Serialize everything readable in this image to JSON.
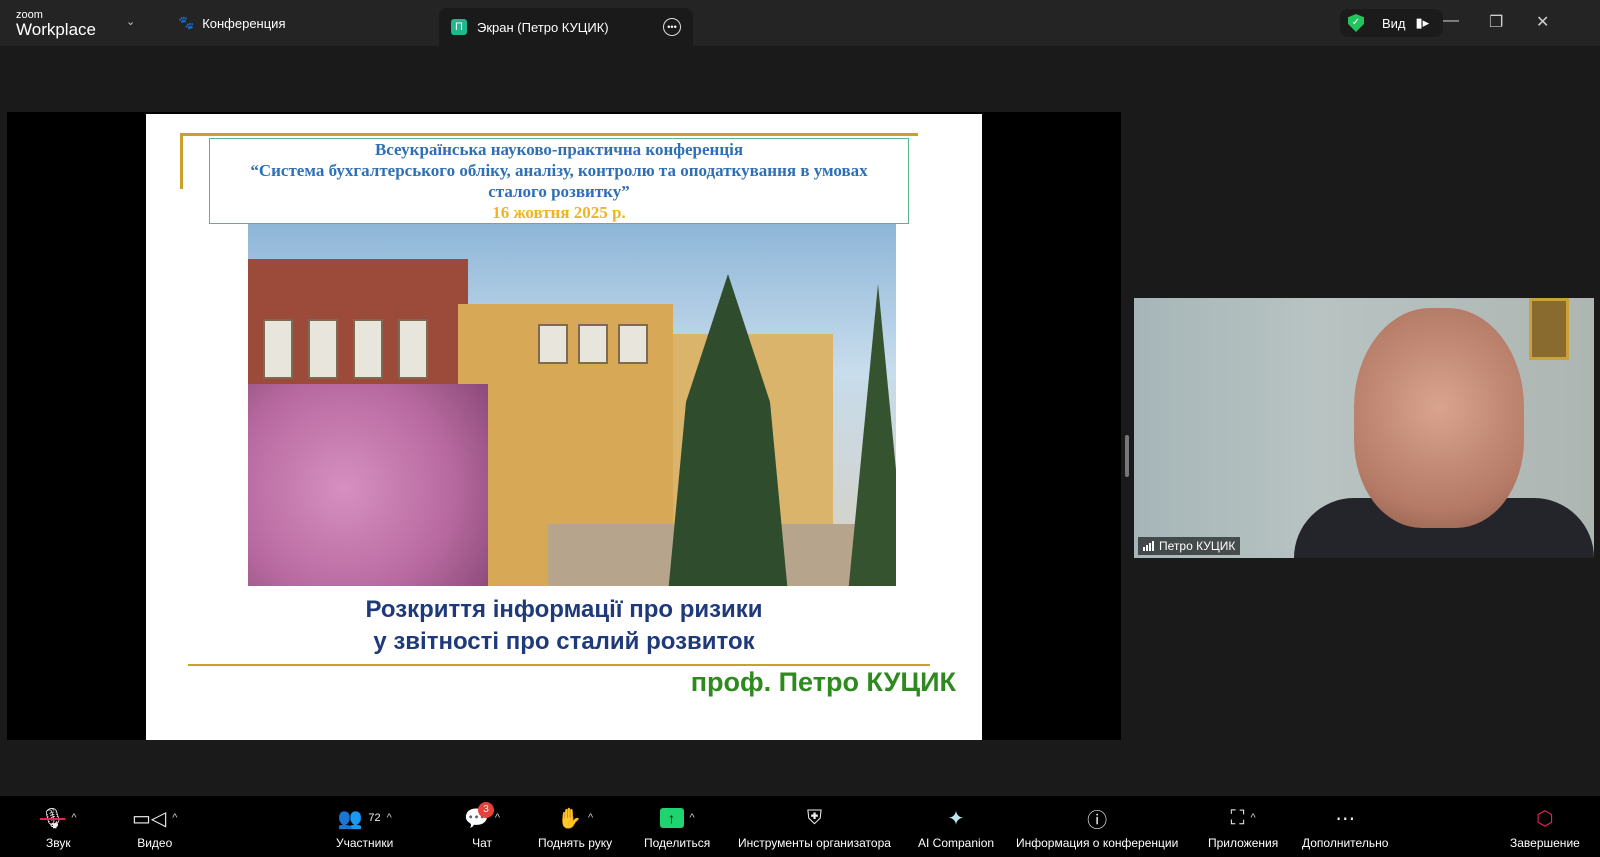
{
  "titlebar": {
    "logo_top": "zoom",
    "logo_bottom": "Workplace",
    "tab_meeting": "Конференция",
    "tab_screen_badge": "П",
    "tab_screen": "Экран (Петро КУЦИК)",
    "view_label": "Вид"
  },
  "slide": {
    "line1": "Всеукраїнська науково-практична конференція",
    "line2": "“Система бухгалтерського обліку, аналізу, контролю та оподаткування в умовах",
    "line3": "сталого розвитку”",
    "date": "16 жовтня 2025 р.",
    "title1": "Розкриття інформації про ризики",
    "title2": "у звітності про сталий розвиток",
    "author": "проф. Петро КУЦИК"
  },
  "video": {
    "name": "Петро КУЦИК"
  },
  "toolbar": {
    "audio": "Звук",
    "video": "Видео",
    "participants": "Участники",
    "participants_count": "72",
    "chat": "Чат",
    "chat_badge": "3",
    "raise_hand": "Поднять руку",
    "share": "Поделиться",
    "host_tools": "Инструменты организатора",
    "ai": "AI Companion",
    "info": "Информация о конференции",
    "apps": "Приложения",
    "more": "Дополнительно",
    "end": "Завершение"
  },
  "colors": {
    "share_green": "#1fd36f",
    "shield_green": "#23c45e",
    "end_red": "#e0245e"
  }
}
